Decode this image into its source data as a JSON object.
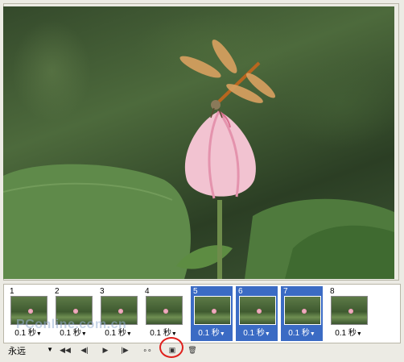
{
  "frames": [
    {
      "number": "1",
      "delay": "0.1 秒",
      "selected": false
    },
    {
      "number": "2",
      "delay": "0.1 秒",
      "selected": false
    },
    {
      "number": "3",
      "delay": "0.1 秒",
      "selected": false
    },
    {
      "number": "4",
      "delay": "0.1 秒",
      "selected": false
    },
    {
      "number": "5",
      "delay": "0.1 秒",
      "selected": true
    },
    {
      "number": "6",
      "delay": "0.1 秒",
      "selected": true
    },
    {
      "number": "7",
      "delay": "0.1 秒",
      "selected": true
    },
    {
      "number": "8",
      "delay": "0.1 秒",
      "selected": false
    }
  ],
  "toolbar": {
    "loop_value": "永远",
    "first_frame_icon": "◀◀",
    "prev_frame_icon": "◀|",
    "play_icon": "▶",
    "next_frame_icon": "|▶",
    "tween_icon": "∘∘",
    "duplicate_icon": "▣",
    "delete_icon": "🗑"
  },
  "watermark": "PConline.com.cn",
  "colors": {
    "selection": "#3b6bc4",
    "highlight_ring": "#e0201c"
  }
}
